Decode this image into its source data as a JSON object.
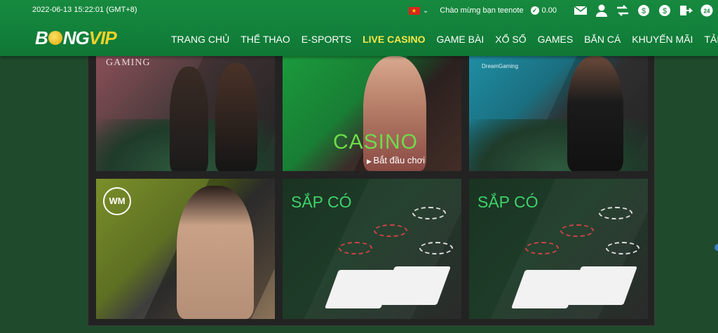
{
  "header": {
    "datetime": "2022-06-13 15:22:01 (GMT+8)",
    "welcome": "Chào mừng bạn teenote",
    "balance": "0.00",
    "flag_icon": "vietnam-flag-icon",
    "icons": [
      "mail-icon",
      "user-icon",
      "transfer-icon",
      "deposit-icon",
      "withdraw-icon",
      "logout-icon",
      "support-24-icon"
    ]
  },
  "logo": {
    "part1": "B",
    "part2": "NG",
    "part3": "VIP"
  },
  "nav": [
    {
      "label": "TRANG CHỦ",
      "active": false
    },
    {
      "label": "THỂ THAO",
      "active": false
    },
    {
      "label": "E-SPORTS",
      "active": false
    },
    {
      "label": "LIVE CASINO",
      "active": true
    },
    {
      "label": "GAME BÀI",
      "active": false
    },
    {
      "label": "XỔ SỐ",
      "active": false
    },
    {
      "label": "GAMES",
      "active": false
    },
    {
      "label": "BẮN CÁ",
      "active": false
    },
    {
      "label": "KHUYẾN MÃI",
      "active": false
    },
    {
      "label": "TẢI APP",
      "active": false
    }
  ],
  "tiles": {
    "ag": {
      "label": "GAMING"
    },
    "ebet": {
      "title": "CASINO",
      "cta": "Bắt đầu chơi"
    },
    "dg": {
      "label": "DreamGaming"
    },
    "wm": {
      "label": "WM"
    },
    "soon1": {
      "label": "SẮP CÓ"
    },
    "soon2": {
      "label": "SẮP CÓ"
    }
  },
  "colors": {
    "header_green": "#12803a",
    "active_nav": "#f6e84a",
    "casino_green": "#6fdc4a"
  }
}
